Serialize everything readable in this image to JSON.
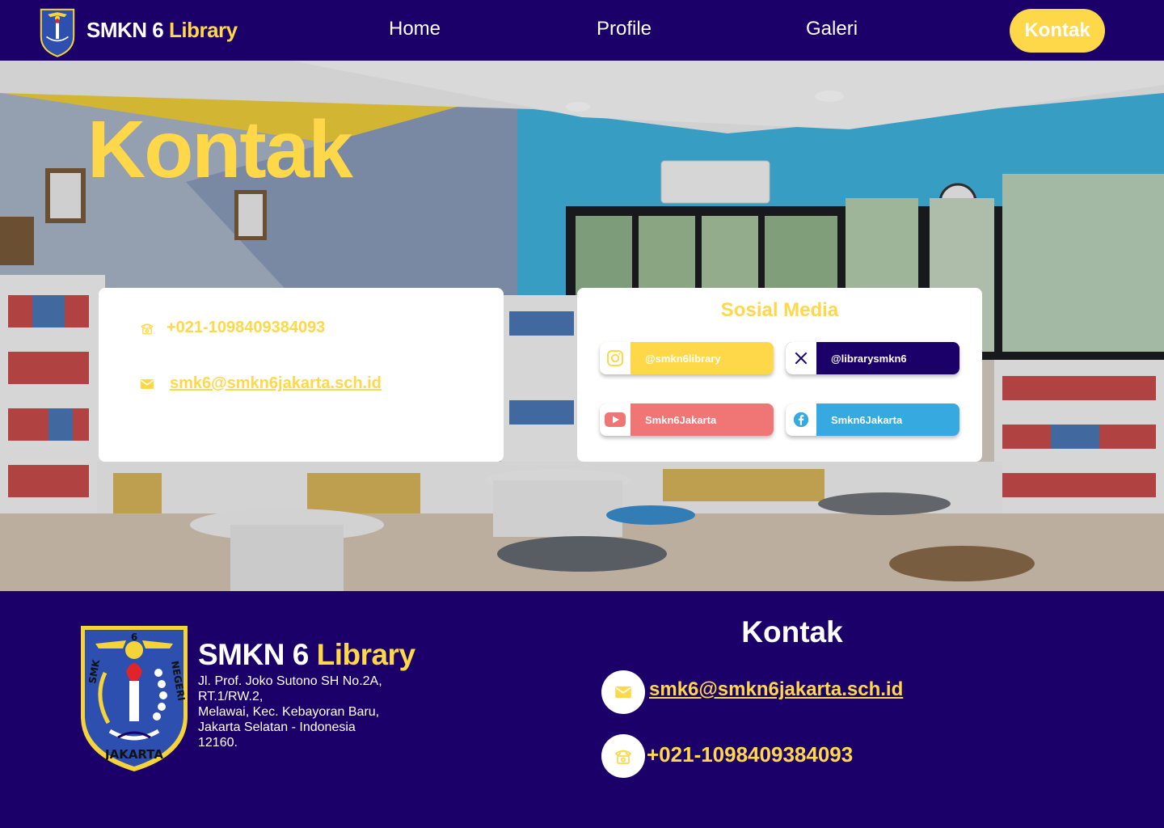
{
  "colors": {
    "navy": "#1a0068",
    "accent_yellow": "#ffd84a",
    "instagram_yellow": "#ffd84a",
    "twitter_navy": "#1a0068",
    "youtube_red": "#f07575",
    "facebook_blue": "#36a9e1"
  },
  "navbar": {
    "brand_main": "SMKN 6",
    "brand_accent": "Library",
    "links": [
      "Home",
      "Profile",
      "Galeri"
    ],
    "active_link": "Kontak"
  },
  "hero": {
    "title": "Kontak",
    "background": "library-room-photo"
  },
  "contact_card": {
    "phone": "+021-1098409384093",
    "phone_icon": "phone-icon",
    "email": "smk6@smkn6jakarta.sch.id",
    "email_icon": "mail-icon"
  },
  "social_card": {
    "title": "Sosial Media",
    "items": [
      {
        "icon": "instagram-icon",
        "label": "@smkn6library"
      },
      {
        "icon": "x-twitter-icon",
        "label": "@librarysmkn6"
      },
      {
        "icon": "youtube-icon",
        "label": "Smkn6Jakarta"
      },
      {
        "icon": "facebook-icon",
        "label": "Smkn6Jakarta"
      }
    ]
  },
  "footer": {
    "brand_main": "SMKN 6",
    "brand_accent": "Library",
    "address_lines": [
      "Jl. Prof. Joko Sutono SH No.2A,",
      "RT.1/RW.2,",
      "Melawai, Kec. Kebayoran Baru,",
      "Jakarta Selatan - Indonesia",
      "12160."
    ],
    "kontak_title": "Kontak",
    "email": "smk6@smkn6jakarta.sch.id",
    "phone": "+021-1098409384093",
    "logo_text_top": "6",
    "logo_text_left": "SMK",
    "logo_text_right": "NEGERI",
    "logo_text_bottom": "JAKARTA"
  }
}
